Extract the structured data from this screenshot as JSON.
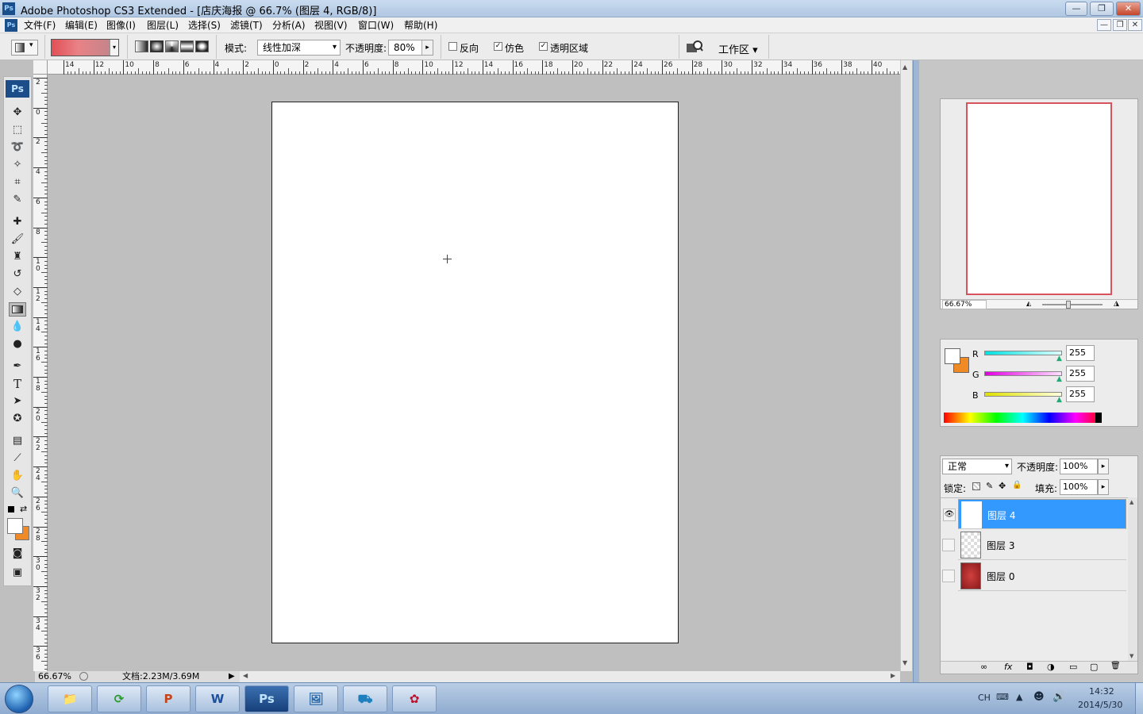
{
  "window": {
    "title": "Adobe Photoshop CS3 Extended - [店庆海报 @ 66.7% (图层 4, RGB/8)]",
    "ps_icon": "Ps"
  },
  "window_controls": {
    "minimize": "—",
    "restore": "❐",
    "close": "✕"
  },
  "doc_controls": {
    "minimize": "—",
    "restore": "❐",
    "close": "✕"
  },
  "menu": {
    "items": [
      "文件(F)",
      "编辑(E)",
      "图像(I)",
      "图层(L)",
      "选择(S)",
      "滤镜(T)",
      "分析(A)",
      "视图(V)",
      "窗口(W)",
      "帮助(H)"
    ]
  },
  "options_bar": {
    "mode_label": "模式:",
    "mode_value": "线性加深",
    "opacity_label": "不透明度:",
    "opacity_value": "80%",
    "reverse_label": "反向",
    "dither_label": "仿色",
    "transparency_label": "透明区域",
    "workspace_label": "工作区 ▾",
    "check_mark": "✓",
    "dropdown_arrow": "▾",
    "flyout_arrow": "▸"
  },
  "toolbox": {
    "logo": "Ps"
  },
  "ruler_h_labels": [
    "14",
    "12",
    "10",
    "8",
    "6",
    "4",
    "2",
    "0",
    "2",
    "4",
    "6",
    "8",
    "10",
    "12",
    "14",
    "16",
    "18",
    "20",
    "22",
    "24",
    "26",
    "28",
    "30",
    "32",
    "34",
    "36",
    "38",
    "40"
  ],
  "ruler_v_labels": [
    "2",
    "0",
    "2",
    "4",
    "6",
    "8",
    "10",
    "12",
    "14",
    "16",
    "18",
    "20",
    "22",
    "24",
    "26",
    "28",
    "30",
    "32",
    "34",
    "36"
  ],
  "status": {
    "zoom": "66.67%",
    "doc_info": "文档:2.23M/3.69M",
    "play_arrow": "▶"
  },
  "navigator": {
    "zoom": "66.67%"
  },
  "color_panel": {
    "channels": [
      {
        "label": "R",
        "value": "255"
      },
      {
        "label": "G",
        "value": "255"
      },
      {
        "label": "B",
        "value": "255"
      }
    ]
  },
  "layers_panel": {
    "blend_mode": "正常",
    "opacity_label": "不透明度:",
    "opacity_value": "100%",
    "lock_label": "锁定:",
    "fill_label": "填充:",
    "fill_value": "100%",
    "layers": [
      {
        "name": "图层 4"
      },
      {
        "name": "图层 3"
      },
      {
        "name": "图层 0"
      }
    ],
    "footer_icons": [
      "∞",
      "fx",
      "◘",
      "◑",
      "▭",
      "▢",
      "🗑"
    ]
  },
  "taskbar": {
    "apps": [
      "📁",
      "⟳",
      "P",
      "W",
      "Ps",
      "🖼",
      "⛟",
      "✿"
    ],
    "tray_lang": "CH",
    "time": "14:32",
    "date": "2014/5/30"
  },
  "colors": {
    "accent": "#3399ff",
    "swatch_fg": "#ffffff",
    "swatch_bg": "#f08a24",
    "gradient_start": "#e14f55"
  }
}
